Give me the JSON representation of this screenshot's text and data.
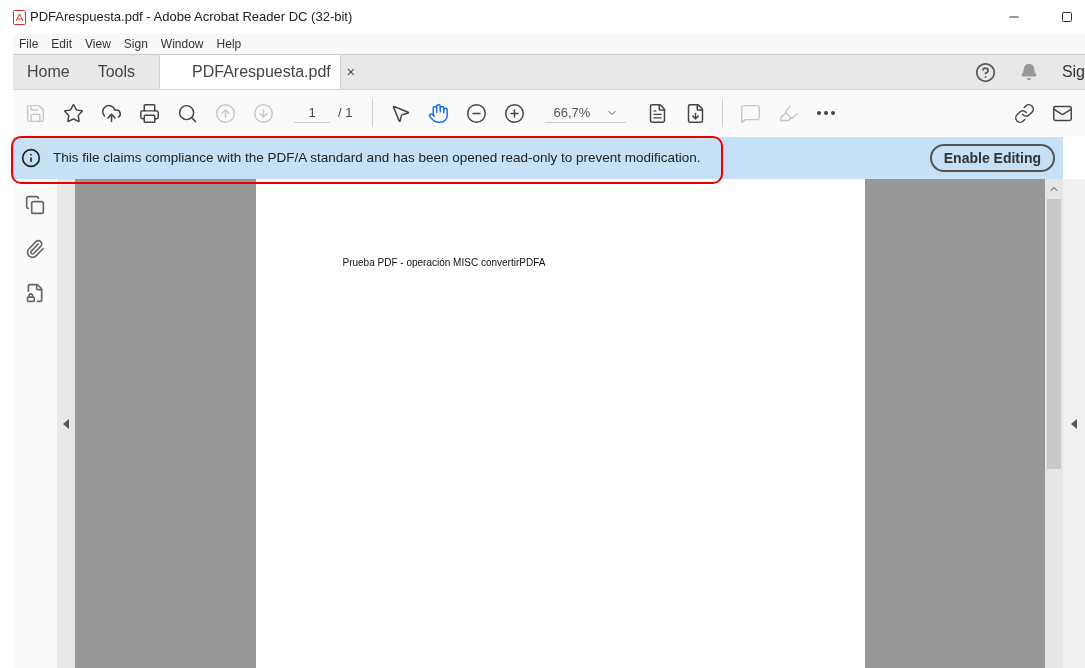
{
  "window": {
    "title": "PDFArespuesta.pdf - Adobe Acrobat Reader DC (32-bit)"
  },
  "menu": [
    "File",
    "Edit",
    "View",
    "Sign",
    "Window",
    "Help"
  ],
  "tabs": [
    {
      "label": "Home",
      "selected": false,
      "kind": "nav"
    },
    {
      "label": "Tools",
      "selected": false,
      "kind": "nav"
    },
    {
      "label": "PDFArespuesta.pdf",
      "selected": true,
      "kind": "document",
      "close": "×"
    }
  ],
  "account": {
    "label": "Sig"
  },
  "toolbar": [
    {
      "kind": "save",
      "disabled": true
    },
    {
      "kind": "bookmark",
      "disabled": false
    },
    {
      "kind": "upload",
      "disabled": false
    },
    {
      "kind": "print",
      "disabled": false
    },
    {
      "kind": "find",
      "disabled": false
    },
    {
      "kind": "prev",
      "disabled": true
    },
    {
      "kind": "next",
      "disabled": true
    },
    {
      "kind": "page"
    },
    {
      "kind": "separator"
    },
    {
      "kind": "select",
      "selected": false
    },
    {
      "kind": "hand",
      "selected": true
    },
    {
      "kind": "zoom-out",
      "disabled": false
    },
    {
      "kind": "zoom-in",
      "disabled": false
    },
    {
      "kind": "zoom"
    },
    {
      "kind": "fit",
      "disabled": false
    },
    {
      "kind": "scroll",
      "disabled": false
    },
    {
      "kind": "separator"
    },
    {
      "kind": "comment",
      "disabled": true
    },
    {
      "kind": "highlight",
      "disabled": true
    },
    {
      "kind": "more",
      "disabled": false
    },
    {
      "kind": "spacer"
    },
    {
      "kind": "share",
      "disabled": false
    },
    {
      "kind": "mail",
      "disabled": false
    }
  ],
  "page_field": {
    "value": "1",
    "total": "/ 1"
  },
  "zoom_field": {
    "value": "66,7%"
  },
  "banner": {
    "message": "This file claims compliance with the PDF/A standard and has been opened read-only to prevent modification.",
    "button": "Enable Editing"
  },
  "document": {
    "text": "Prueba PDF - operación MISC convertirPDFA"
  }
}
